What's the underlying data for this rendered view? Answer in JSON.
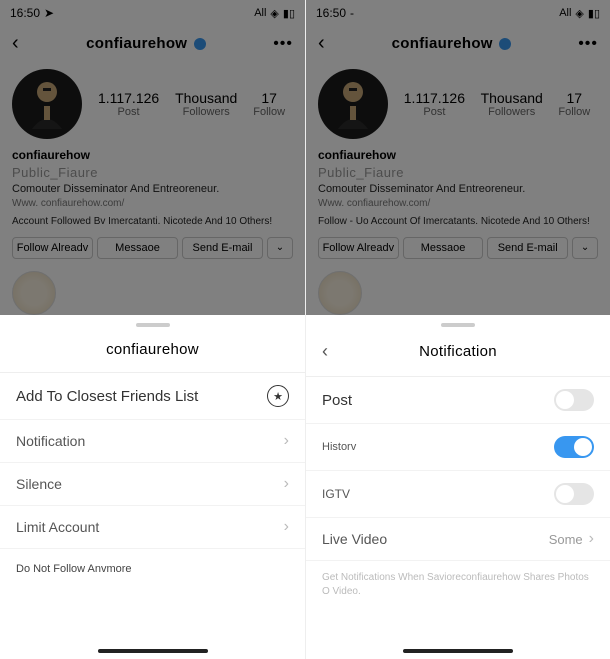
{
  "status": {
    "time": "16:50",
    "net": "All"
  },
  "profile": {
    "handle": "confiaurehow",
    "stats": [
      {
        "num": "1.117.126",
        "label": "Post"
      },
      {
        "num": "Thousand",
        "label": "Followers"
      },
      {
        "num": "17",
        "label": "Follow"
      }
    ],
    "name": "confiaurehow",
    "category": "Public_Fiaure",
    "desc": "Comouter Disseminator And Entreoreneur.",
    "link": "Www. confiaurehow.com/",
    "followed_left": "Account Followed Bv Imercatanti. Nicotede And 10 Others!",
    "followed_right": "Follow - Uo Account Of Imercatants. Nicotede And 10 Others!",
    "btn1": "Follow Alreadv",
    "btn2": "Messaoe",
    "btn3": "Send E-mail"
  },
  "sheet_left": {
    "title": "confiaurehow",
    "items": [
      {
        "label": "Add To Closest Friends List",
        "key": "closest"
      },
      {
        "label": "Notification",
        "key": "notifications"
      },
      {
        "label": "Silence",
        "key": "silence"
      },
      {
        "label": "Limit Account",
        "key": "limit"
      }
    ],
    "unfollow": "Do Not Follow Anvmore"
  },
  "sheet_right": {
    "title": "Notification",
    "items": [
      {
        "label": "Post",
        "toggle": "off"
      },
      {
        "label": "Historv",
        "toggle": "on"
      },
      {
        "label": "IGTV",
        "toggle": "off"
      },
      {
        "label": "Live Video",
        "value": "Some"
      }
    ],
    "hint": "Get Notifications When Savioreconfiaurehow Shares Photos O Video."
  }
}
